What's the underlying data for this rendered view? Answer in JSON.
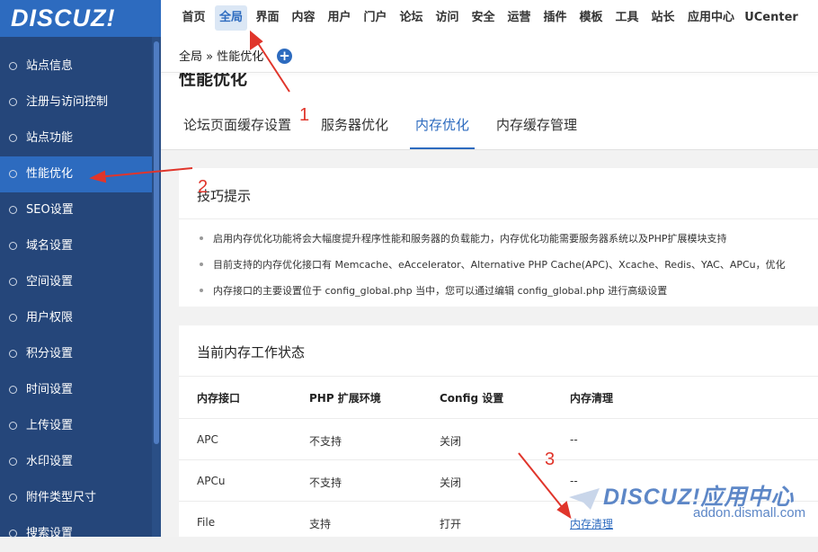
{
  "app": {
    "logo": "DISCUZ!"
  },
  "topnav": {
    "items": [
      "首页",
      "全局",
      "界面",
      "内容",
      "用户",
      "门户",
      "论坛",
      "访问",
      "安全",
      "运营",
      "插件",
      "模板",
      "工具",
      "站长",
      "应用中心",
      "UCenter"
    ],
    "active": "全局"
  },
  "sidebar": {
    "items": [
      "站点信息",
      "注册与访问控制",
      "站点功能",
      "性能优化",
      "SEO设置",
      "域名设置",
      "空间设置",
      "用户权限",
      "积分设置",
      "时间设置",
      "上传设置",
      "水印设置",
      "附件类型尺寸",
      "搜索设置"
    ],
    "active": "性能优化"
  },
  "breadcrumb": "全局 » 性能优化",
  "page_title": "性能优化",
  "tabs": [
    "论坛页面缓存设置",
    "服务器优化",
    "内存优化",
    "内存缓存管理"
  ],
  "active_tab": "内存优化",
  "tips": {
    "title": "技巧提示",
    "items": [
      "启用内存优化功能将会大幅度提升程序性能和服务器的负载能力，内存优化功能需要服务器系统以及PHP扩展模块支持",
      "目前支持的内存优化接口有 Memcache、eAccelerator、Alternative PHP Cache(APC)、Xcache、Redis、YAC、APCu，优化",
      "内存接口的主要设置位于 config_global.php 当中，您可以通过编辑 config_global.php 进行高级设置"
    ]
  },
  "status": {
    "title": "当前内存工作状态",
    "columns": [
      "内存接口",
      "PHP 扩展环境",
      "Config 设置",
      "内存清理"
    ],
    "rows": [
      [
        "APC",
        "不支持",
        "关闭",
        "--"
      ],
      [
        "APCu",
        "不支持",
        "关闭",
        "--"
      ],
      [
        "File",
        "支持",
        "打开",
        "内存清理"
      ]
    ]
  },
  "annotations": [
    "1",
    "2",
    "3"
  ],
  "watermark": {
    "title": "DISCUZ!应用中心",
    "url": "addon.dismall.com"
  },
  "colors": {
    "brand": "#2d6bbf",
    "sidebar": "#25467a",
    "annotation": "#e0352b"
  }
}
